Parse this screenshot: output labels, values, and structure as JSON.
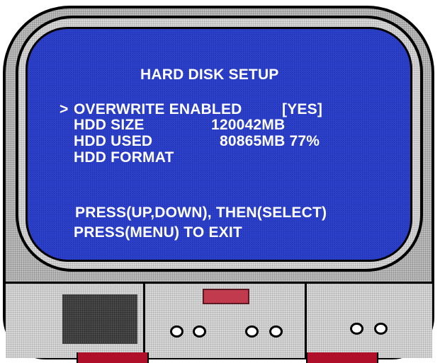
{
  "osd": {
    "title": "HARD DISK SETUP",
    "cursor": ">",
    "rows": [
      {
        "label": "OVERWRITE ENABLED",
        "value": "[YES]"
      },
      {
        "label": "HDD SIZE",
        "value": "120042MB"
      },
      {
        "label": "HDD USED",
        "value": "80865MB 77%"
      },
      {
        "label": "HDD FORMAT",
        "value": ""
      }
    ],
    "hint_navigate": "PRESS(UP,DOWN), THEN(SELECT)",
    "hint_exit": "PRESS(MENU) TO EXIT"
  },
  "colors": {
    "screen": "#2b3fc8",
    "casing": "#bdbdbd",
    "indicator": "#c23a4e",
    "feet": "#b00f2a"
  }
}
